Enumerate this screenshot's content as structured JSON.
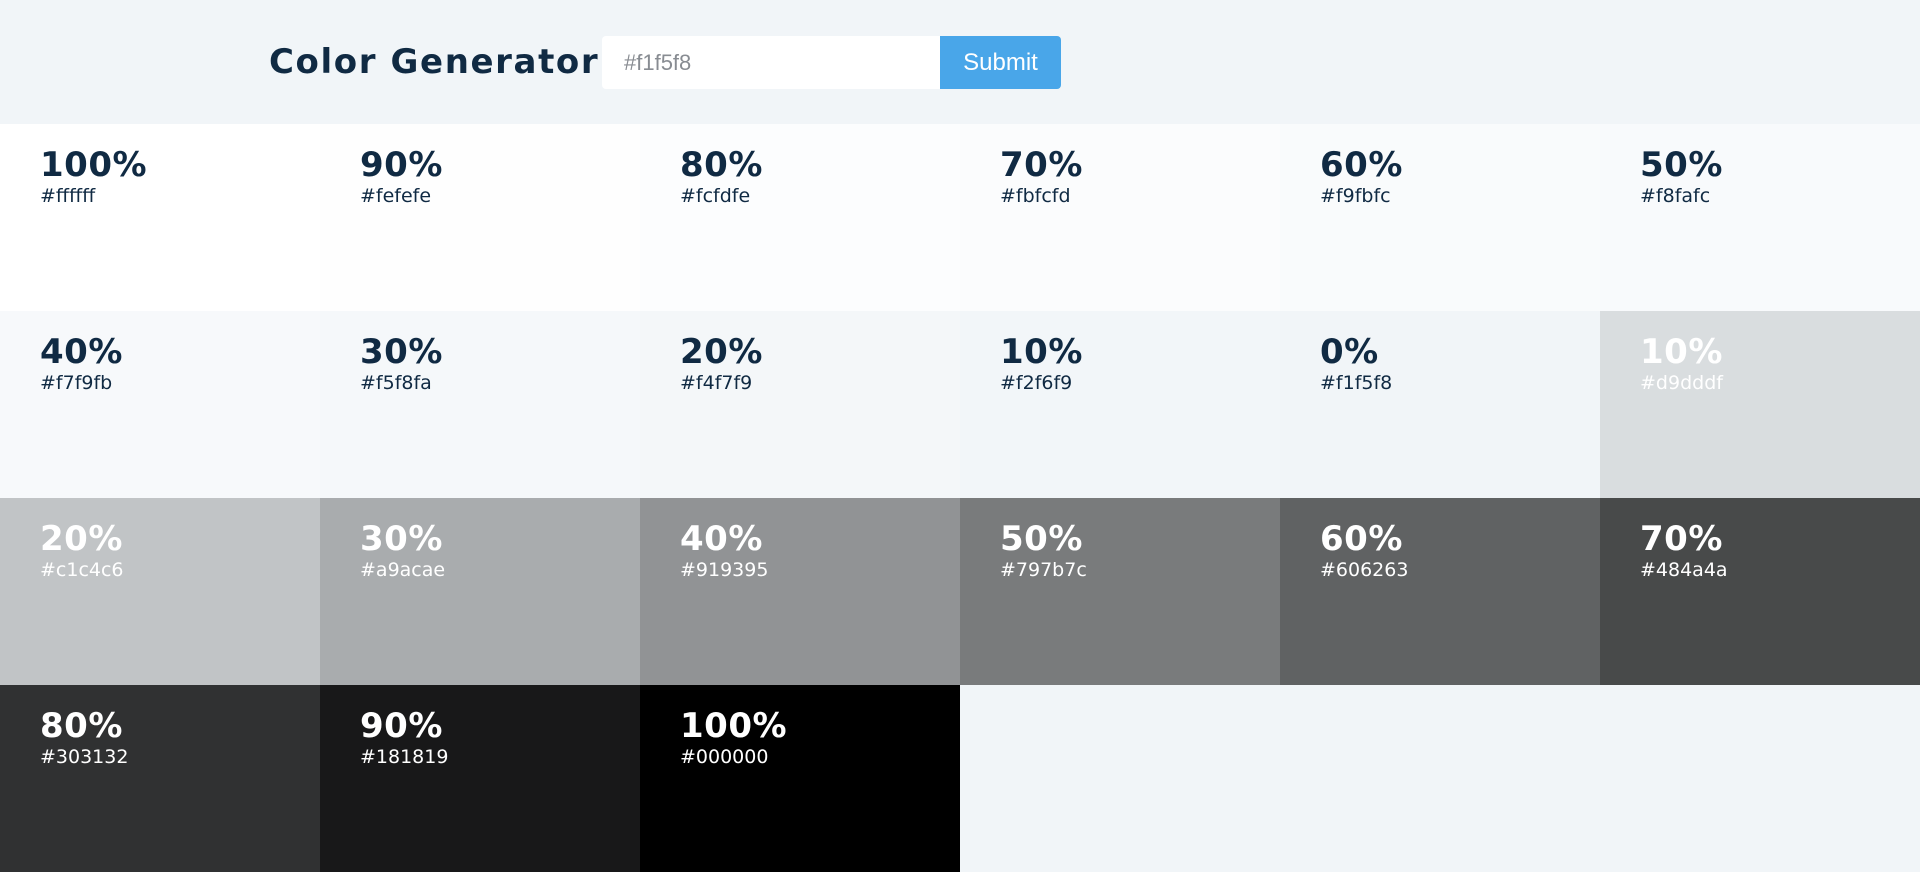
{
  "header": {
    "title": "Color Generator",
    "input_value": "#f1f5f8",
    "submit_label": "Submit",
    "accent_color": "#49a6e9"
  },
  "tiles": [
    {
      "percent": "100%",
      "hex": "#ffffff",
      "text_color": "#102a43"
    },
    {
      "percent": "90%",
      "hex": "#fefefe",
      "text_color": "#102a43"
    },
    {
      "percent": "80%",
      "hex": "#fcfdfe",
      "text_color": "#102a43"
    },
    {
      "percent": "70%",
      "hex": "#fbfcfd",
      "text_color": "#102a43"
    },
    {
      "percent": "60%",
      "hex": "#f9fbfc",
      "text_color": "#102a43"
    },
    {
      "percent": "50%",
      "hex": "#f8fafc",
      "text_color": "#102a43"
    },
    {
      "percent": "40%",
      "hex": "#f7f9fb",
      "text_color": "#102a43"
    },
    {
      "percent": "30%",
      "hex": "#f5f8fa",
      "text_color": "#102a43"
    },
    {
      "percent": "20%",
      "hex": "#f4f7f9",
      "text_color": "#102a43"
    },
    {
      "percent": "10%",
      "hex": "#f2f6f9",
      "text_color": "#102a43"
    },
    {
      "percent": "0%",
      "hex": "#f1f5f8",
      "text_color": "#102a43"
    },
    {
      "percent": "10%",
      "hex": "#d9dddf",
      "text_color": "#ffffff"
    },
    {
      "percent": "20%",
      "hex": "#c1c4c6",
      "text_color": "#ffffff"
    },
    {
      "percent": "30%",
      "hex": "#a9acae",
      "text_color": "#ffffff"
    },
    {
      "percent": "40%",
      "hex": "#919395",
      "text_color": "#ffffff"
    },
    {
      "percent": "50%",
      "hex": "#797b7c",
      "text_color": "#ffffff"
    },
    {
      "percent": "60%",
      "hex": "#606263",
      "text_color": "#ffffff"
    },
    {
      "percent": "70%",
      "hex": "#484a4a",
      "text_color": "#ffffff"
    },
    {
      "percent": "80%",
      "hex": "#303132",
      "text_color": "#ffffff"
    },
    {
      "percent": "90%",
      "hex": "#181819",
      "text_color": "#ffffff"
    },
    {
      "percent": "100%",
      "hex": "#000000",
      "text_color": "#ffffff"
    }
  ]
}
